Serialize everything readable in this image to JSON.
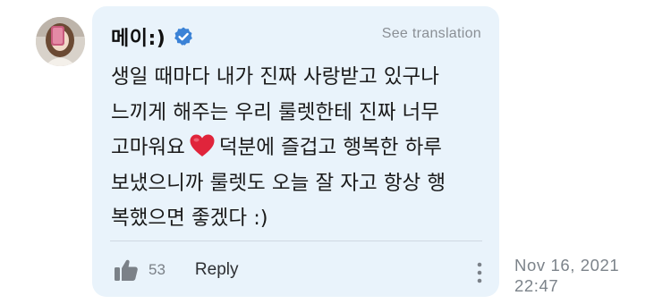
{
  "comment": {
    "author": "메이:)",
    "see_translation": "See translation",
    "text_before_heart": "생일 때마다 내가 진짜 사랑받고 있구나\n느끼게 해주는 우리 룰렛한테 진짜 너무\n고마워요",
    "text_after_heart": "덕분에 즐겁고 행복한 하루\n보냈으니까 룰렛도 오늘 잘 자고 항상 행\n복했으면 좋겠다 :)",
    "like_count": "53",
    "reply_label": "Reply",
    "timestamp_date": "Nov 16, 2021",
    "timestamp_time": "22:47"
  },
  "icons": {
    "verified": "verified-badge-icon",
    "heart": "red-heart-emoji",
    "like": "thumbs-up-icon",
    "more": "vertical-dots-icon"
  },
  "colors": {
    "bubble_bg": "#e9f3fb",
    "verified_blue": "#3b82d6",
    "heart_red": "#e0243b",
    "muted_text": "#7c838a"
  }
}
